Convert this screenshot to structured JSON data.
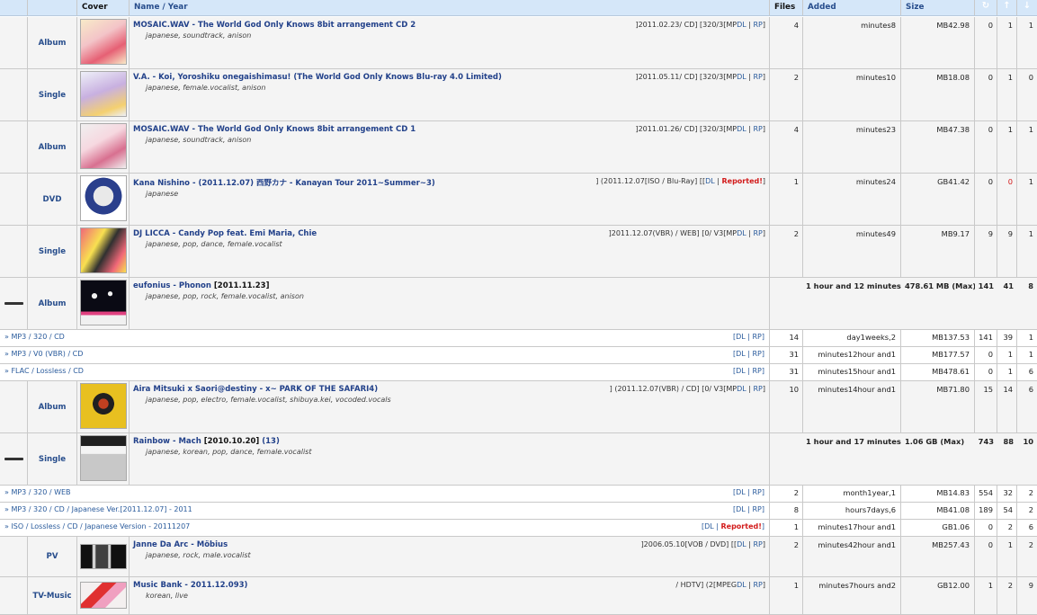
{
  "header": {
    "cover": "Cover",
    "name_year": "Name / Year",
    "files": "Files",
    "added": "Added",
    "size": "Size",
    "snatched_icon": "↻",
    "seeders_icon": "↑",
    "leechers_icon": "↓"
  },
  "rows": [
    {
      "category": "Album",
      "title": "MOSAIC.WAV - The World God Only Knows 8bit arrangement CD 2",
      "tags": "japanese, soundtrack, anison",
      "meta": "]2011.02.23/ CD] [320/3[MP",
      "dl": "DL",
      "rp": "RP",
      "files": "4",
      "added": "minutes8",
      "size": "MB42.98",
      "snatched": "0",
      "seeders": "1",
      "leechers": "1",
      "cover_colors": [
        "#f3c4c8",
        "#e66074",
        "#f8eac8"
      ]
    },
    {
      "category": "Single",
      "title": "V.A. - Koi, Yoroshiku onegaishimasu! (The World God Only Knows Blu-ray 4.0 Limited)",
      "tags": "japanese, female.vocalist, anison",
      "meta": "]2011.05.11/ CD] [320/3[MP",
      "dl": "DL",
      "rp": "RP",
      "files": "2",
      "added": "minutes10",
      "size": "MB18.08",
      "snatched": "0",
      "seeders": "1",
      "leechers": "0",
      "cover_colors": [
        "#eef0f8",
        "#c8b0e0",
        "#f4d070"
      ]
    },
    {
      "category": "Album",
      "title": "MOSAIC.WAV - The World God Only Knows 8bit arrangement CD 1",
      "tags": "japanese, soundtrack, anison",
      "meta": "]2011.01.26/ CD] [320/3[MP",
      "dl": "DL",
      "rp": "RP",
      "files": "4",
      "added": "minutes23",
      "size": "MB47.38",
      "snatched": "0",
      "seeders": "1",
      "leechers": "1",
      "cover_colors": [
        "#f6d8e0",
        "#d87090",
        "#f0f0f0"
      ]
    },
    {
      "category": "DVD",
      "title": "Kana Nishino - (2011.12.07) 西野カナ - Kanayan Tour 2011~Summer~3)",
      "tags": "japanese",
      "meta": "] (2011.12.07[ISO / Blu-Ray] [[",
      "dl": "DL",
      "rp": "Reported!",
      "files": "1",
      "added": "minutes24",
      "size": "GB41.42",
      "snatched": "0",
      "seeders": "0",
      "leechers": "1",
      "cover_colors": [
        "#ffffff",
        "#2a3f8c",
        "#e9e9e9"
      ]
    },
    {
      "category": "Single",
      "title": "DJ LICCA - Candy Pop feat. Emi Maria, Chie",
      "tags": "japanese, pop, dance, female.vocalist",
      "meta": "]2011.12.07(VBR) / WEB] [0/ V3[MP",
      "dl": "DL",
      "rp": "RP",
      "files": "2",
      "added": "minutes49",
      "size": "MB9.17",
      "snatched": "9",
      "seeders": "9",
      "leechers": "1",
      "cover_colors": [
        "#f06878",
        "#f8e050",
        "#303030"
      ]
    },
    {
      "category": "Album",
      "title": "eufonius - Phonon",
      "year": "[2011.11.23]",
      "tags": "japanese, pop, rock, female.vocalist, anison",
      "added": "1 hour and 12 minutes",
      "size": "478.61 MB (Max)",
      "snatched": "141",
      "seeders": "41",
      "leechers": "8",
      "cover_colors": [
        "#0a0a14",
        "#f0f0f0",
        "#e04080"
      ]
    },
    {
      "format": "» MP3 / 320 / CD",
      "dl": "DL",
      "rp": "RP",
      "files": "14",
      "added": "day1weeks,2",
      "size": "MB137.53",
      "snatched": "141",
      "seeders": "39",
      "leechers": "1"
    },
    {
      "format": "» MP3 / V0 (VBR) / CD",
      "dl": "DL",
      "rp": "RP",
      "files": "31",
      "added": "minutes12hour and1",
      "size": "MB177.57",
      "snatched": "0",
      "seeders": "1",
      "leechers": "1"
    },
    {
      "format": "» FLAC / Lossless / CD",
      "dl": "DL",
      "rp": "RP",
      "files": "31",
      "added": "minutes15hour and1",
      "size": "MB478.61",
      "snatched": "0",
      "seeders": "1",
      "leechers": "6"
    },
    {
      "category": "Album",
      "title": "Aira Mitsuki x Saori@destiny - x~ PARK OF THE SAFARI4)",
      "tags": "japanese, pop, electro, female.vocalist, shibuya.kei, vocoded.vocals",
      "meta": "] (2011.12.07(VBR) / CD] [0/ V3[MP",
      "dl": "DL",
      "rp": "RP",
      "files": "10",
      "added": "minutes14hour and1",
      "size": "MB71.80",
      "snatched": "15",
      "seeders": "14",
      "leechers": "6",
      "cover_colors": [
        "#e8c020",
        "#202020",
        "#c04020"
      ]
    },
    {
      "category": "Single",
      "title": "Rainbow - Mach",
      "year": "[2010.10.20]",
      "count": "(13)",
      "tags": "japanese, korean, pop, dance, female.vocalist",
      "added": "1 hour and 17 minutes",
      "size": "1.06 GB (Max)",
      "snatched": "743",
      "seeders": "88",
      "leechers": "10",
      "cover_colors": [
        "#f4f4f4",
        "#202020",
        "#c8c8c8"
      ]
    },
    {
      "format": "» MP3 / 320 / WEB",
      "dl": "DL",
      "rp": "RP",
      "files": "2",
      "added": "month1year,1",
      "size": "MB14.83",
      "snatched": "554",
      "seeders": "32",
      "leechers": "2"
    },
    {
      "format": "» MP3 / 320 / CD / Japanese Ver.[2011.12.07] - 2011",
      "dl": "DL",
      "rp": "RP",
      "files": "8",
      "added": "hours7days,6",
      "size": "MB41.08",
      "snatched": "189",
      "seeders": "54",
      "leechers": "2"
    },
    {
      "format": "» ISO / Lossless / CD / Japanese Version - 20111207",
      "dl": "DL",
      "rp": "Reported!",
      "files": "1",
      "added": "minutes17hour and1",
      "size": "GB1.06",
      "snatched": "0",
      "seeders": "2",
      "leechers": "6"
    },
    {
      "category": "PV",
      "title": "Janne Da Arc - Möbius",
      "tags": "japanese, rock, male.vocalist",
      "meta": "]2006.05.10[VOB / DVD] [[",
      "dl": "DL",
      "rp": "RP",
      "files": "2",
      "added": "minutes42hour and1",
      "size": "MB257.43",
      "snatched": "0",
      "seeders": "1",
      "leechers": "2",
      "cover_colors": [
        "#101010",
        "#d0d0d0",
        "#404040"
      ]
    },
    {
      "category": "TV-Music",
      "title": "Music Bank - 2011.12.093)",
      "tags": "korean, live",
      "meta": "/ HDTV] (2[MPEG",
      "dl": "DL",
      "rp": "RP",
      "files": "1",
      "added": "minutes7hours and2",
      "size": "GB12.00",
      "snatched": "1",
      "seeders": "2",
      "leechers": "9",
      "cover_colors": [
        "#f4f0f0",
        "#e03030",
        "#f0a0c0"
      ]
    }
  ]
}
